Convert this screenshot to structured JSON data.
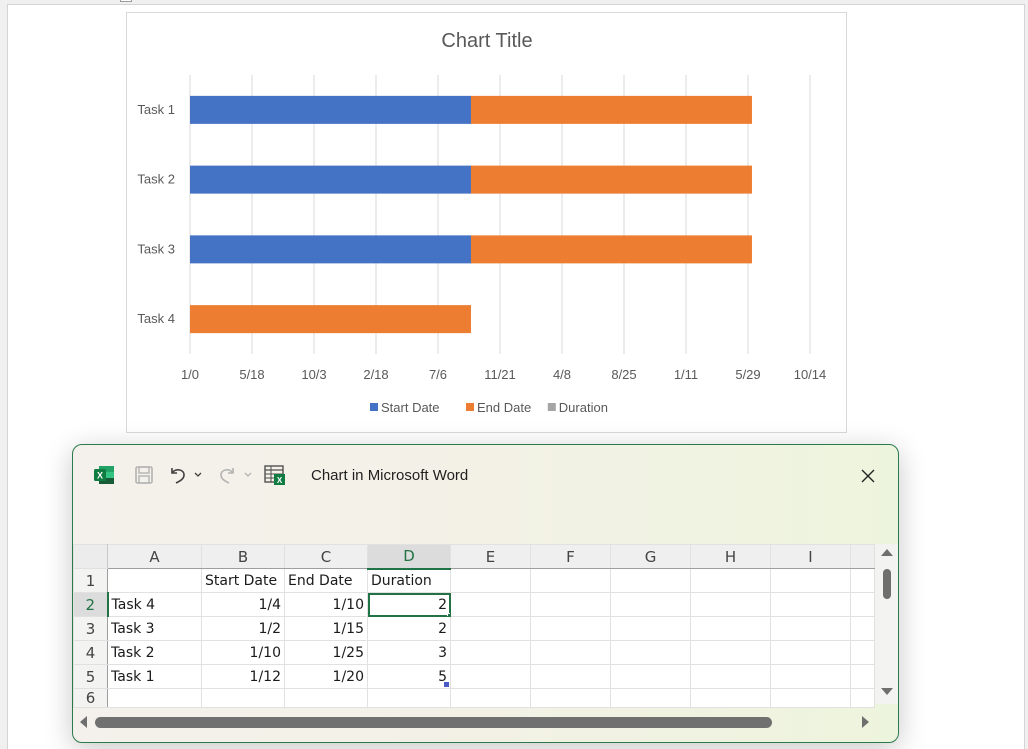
{
  "chart_data": {
    "type": "bar",
    "orientation": "horizontal",
    "stacked": true,
    "title": "Chart Title",
    "categories": [
      "Task 4",
      "Task 3",
      "Task 2",
      "Task 1"
    ],
    "series": [
      {
        "name": "Start Date",
        "color": "#4472c4",
        "values": [
          0,
          2266,
          2266,
          2266
        ]
      },
      {
        "name": "End Date",
        "color": "#ed7d31",
        "values": [
          2266,
          2266,
          2266,
          2266
        ]
      },
      {
        "name": "Duration",
        "color": "#a5a5a5",
        "values": [
          0,
          0,
          0,
          0
        ]
      }
    ],
    "x_tick_labels": [
      "1/0",
      "5/18",
      "10/3",
      "2/18",
      "7/6",
      "11/21",
      "4/8",
      "8/25",
      "1/11",
      "5/29",
      "10/14"
    ],
    "x_tick_values": [
      0,
      500,
      1000,
      1500,
      2000,
      2500,
      3000,
      3500,
      4000,
      4500,
      5000
    ],
    "xlim": [
      0,
      5000
    ],
    "xlabel": "",
    "ylabel": "",
    "grid": true,
    "legend": "bottom"
  },
  "popup": {
    "title": "Chart in Microsoft Word",
    "icons": [
      "excel-logo-icon",
      "save-icon",
      "undo-icon",
      "undo-dropdown-icon",
      "redo-icon",
      "redo-dropdown-icon",
      "edit-data-in-excel-icon"
    ],
    "close_icon": "close-icon"
  },
  "sheet": {
    "columns": [
      "A",
      "B",
      "C",
      "D",
      "E",
      "F",
      "G",
      "H",
      "I"
    ],
    "active_column": "D",
    "active_row": 2,
    "rows": [
      {
        "num": "1",
        "cells": [
          "",
          "Start Date",
          "End Date",
          "Duration",
          "",
          "",
          "",
          "",
          ""
        ]
      },
      {
        "num": "2",
        "cells": [
          "Task 4",
          "1/4",
          "1/10",
          "2",
          "",
          "",
          "",
          "",
          ""
        ]
      },
      {
        "num": "3",
        "cells": [
          "Task 3",
          "1/2",
          "1/15",
          "2",
          "",
          "",
          "",
          "",
          ""
        ]
      },
      {
        "num": "4",
        "cells": [
          "Task 2",
          "1/10",
          "1/25",
          "3",
          "",
          "",
          "",
          "",
          ""
        ]
      },
      {
        "num": "5",
        "cells": [
          "Task 1",
          "1/12",
          "1/20",
          "5",
          "",
          "",
          "",
          "",
          ""
        ]
      },
      {
        "num": "6",
        "cells": [
          "",
          "",
          "",
          "",
          "",
          "",
          "",
          "",
          ""
        ]
      }
    ]
  },
  "colors": {
    "excel_green": "#217346",
    "popup_border": "#2b7a4b",
    "bar_blue": "#4472c4",
    "bar_orange": "#ed7d31",
    "legend_gray": "#a5a5a5"
  }
}
